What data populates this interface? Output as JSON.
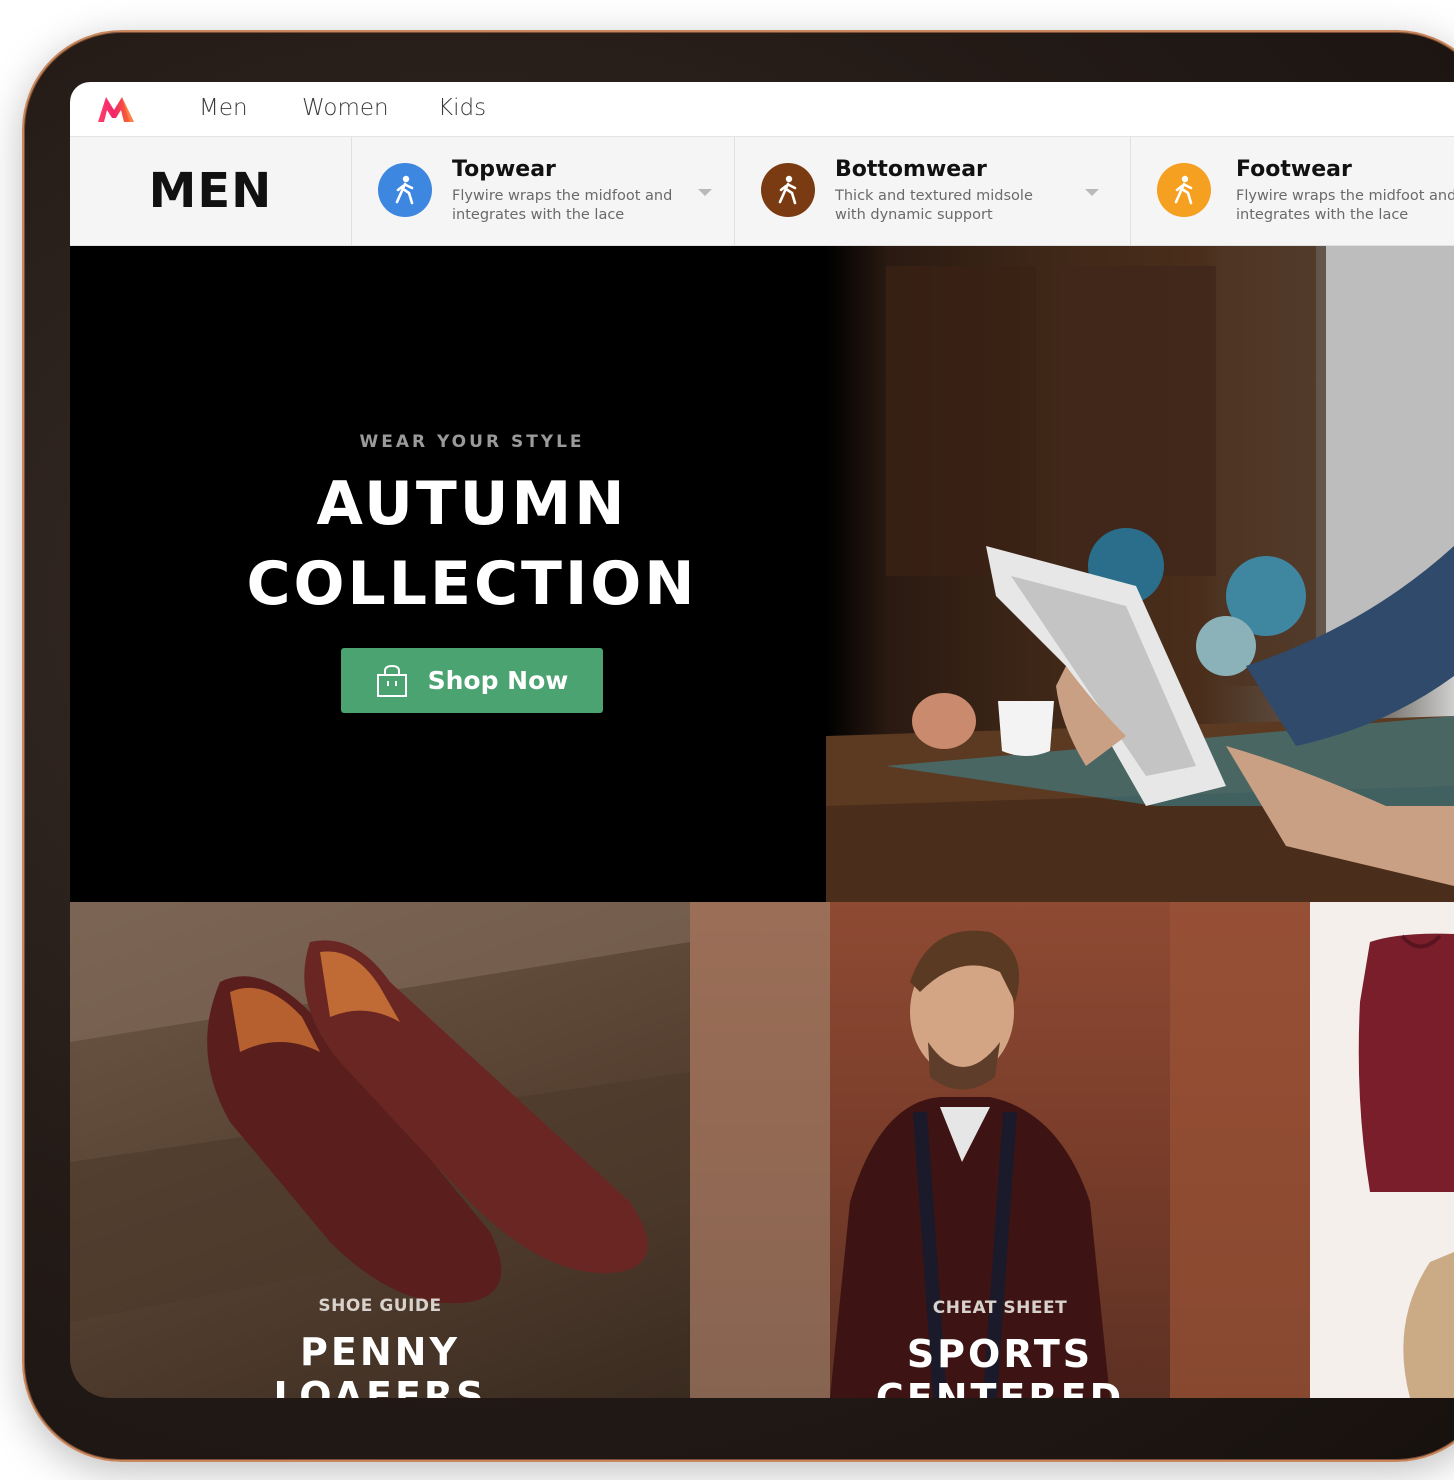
{
  "brand": {
    "logo_icon": "myntra-logo-icon"
  },
  "nav": {
    "items": [
      {
        "label": "Men"
      },
      {
        "label": "Women"
      },
      {
        "label": "Kids"
      }
    ]
  },
  "catbar": {
    "title": "MEN",
    "categories": [
      {
        "title": "Topwear",
        "description": "Flywire wraps the midfoot and integrates with the lace",
        "icon": "walking-person-icon",
        "color": "#3d87e0"
      },
      {
        "title": "Bottomwear",
        "description": "Thick and textured midsole with dynamic support",
        "icon": "walking-person-icon",
        "color": "#7a3b12"
      },
      {
        "title": "Footwear",
        "description": "Flywire wraps the midfoot and integrates with the lace",
        "icon": "walking-person-icon",
        "color": "#f5a020"
      }
    ]
  },
  "hero": {
    "eyebrow": "WEAR YOUR STYLE",
    "title_line1": "AUTUMN",
    "title_line2": "COLLECTION",
    "button_label": "Shop Now",
    "button_icon": "shopping-bag-icon",
    "button_color": "#4aa371"
  },
  "tiles": [
    {
      "kicker": "SHOE GUIDE",
      "title_line1": "PENNY",
      "title_line2": "LOAFERS"
    },
    {
      "kicker": "CHEAT SHEET",
      "title_line1": "SPORTS",
      "title_line2": "CENTERED"
    }
  ]
}
